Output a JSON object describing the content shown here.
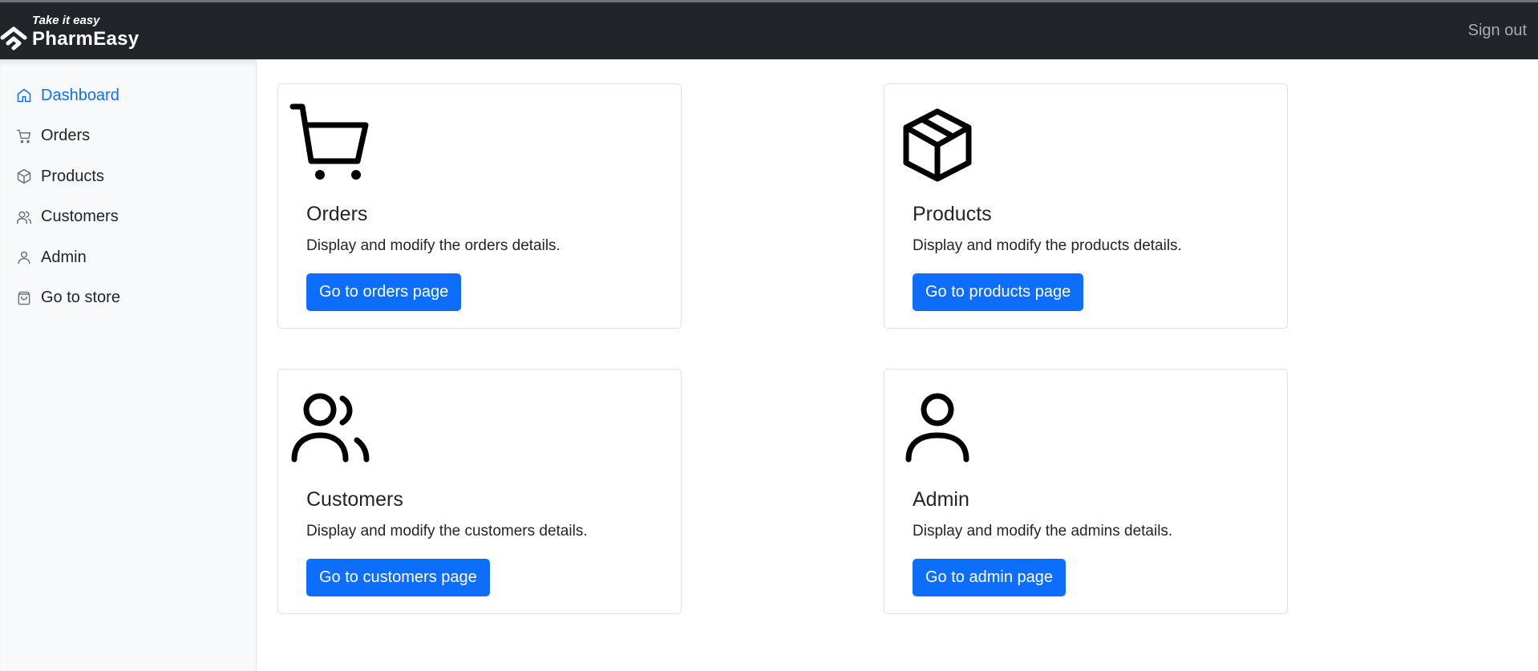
{
  "header": {
    "tagline": "Take it easy",
    "brand": "PharmEasy",
    "sign_out": "Sign out"
  },
  "sidebar": {
    "items": [
      {
        "label": "Dashboard",
        "icon": "house-icon",
        "active": true
      },
      {
        "label": "Orders",
        "icon": "cart-icon"
      },
      {
        "label": "Products",
        "icon": "box-icon"
      },
      {
        "label": "Customers",
        "icon": "users-icon"
      },
      {
        "label": "Admin",
        "icon": "user-icon"
      },
      {
        "label": "Go to store",
        "icon": "shopping-bag-icon"
      }
    ]
  },
  "cards": [
    {
      "title": "Orders",
      "text": "Display and modify the orders details.",
      "button": "Go to orders page",
      "icon": "cart-icon"
    },
    {
      "title": "Products",
      "text": "Display and modify the products details.",
      "button": "Go to products page",
      "icon": "box-icon"
    },
    {
      "title": "Customers",
      "text": "Display and modify the customers details.",
      "button": "Go to customers page",
      "icon": "users-icon"
    },
    {
      "title": "Admin",
      "text": "Display and modify the admins details.",
      "button": "Go to admin page",
      "icon": "user-icon"
    }
  ],
  "colors": {
    "topbar": "#212529",
    "sidebar": "#f8f9fa",
    "primary": "#0d6efd",
    "muted": "#a9acaf"
  }
}
